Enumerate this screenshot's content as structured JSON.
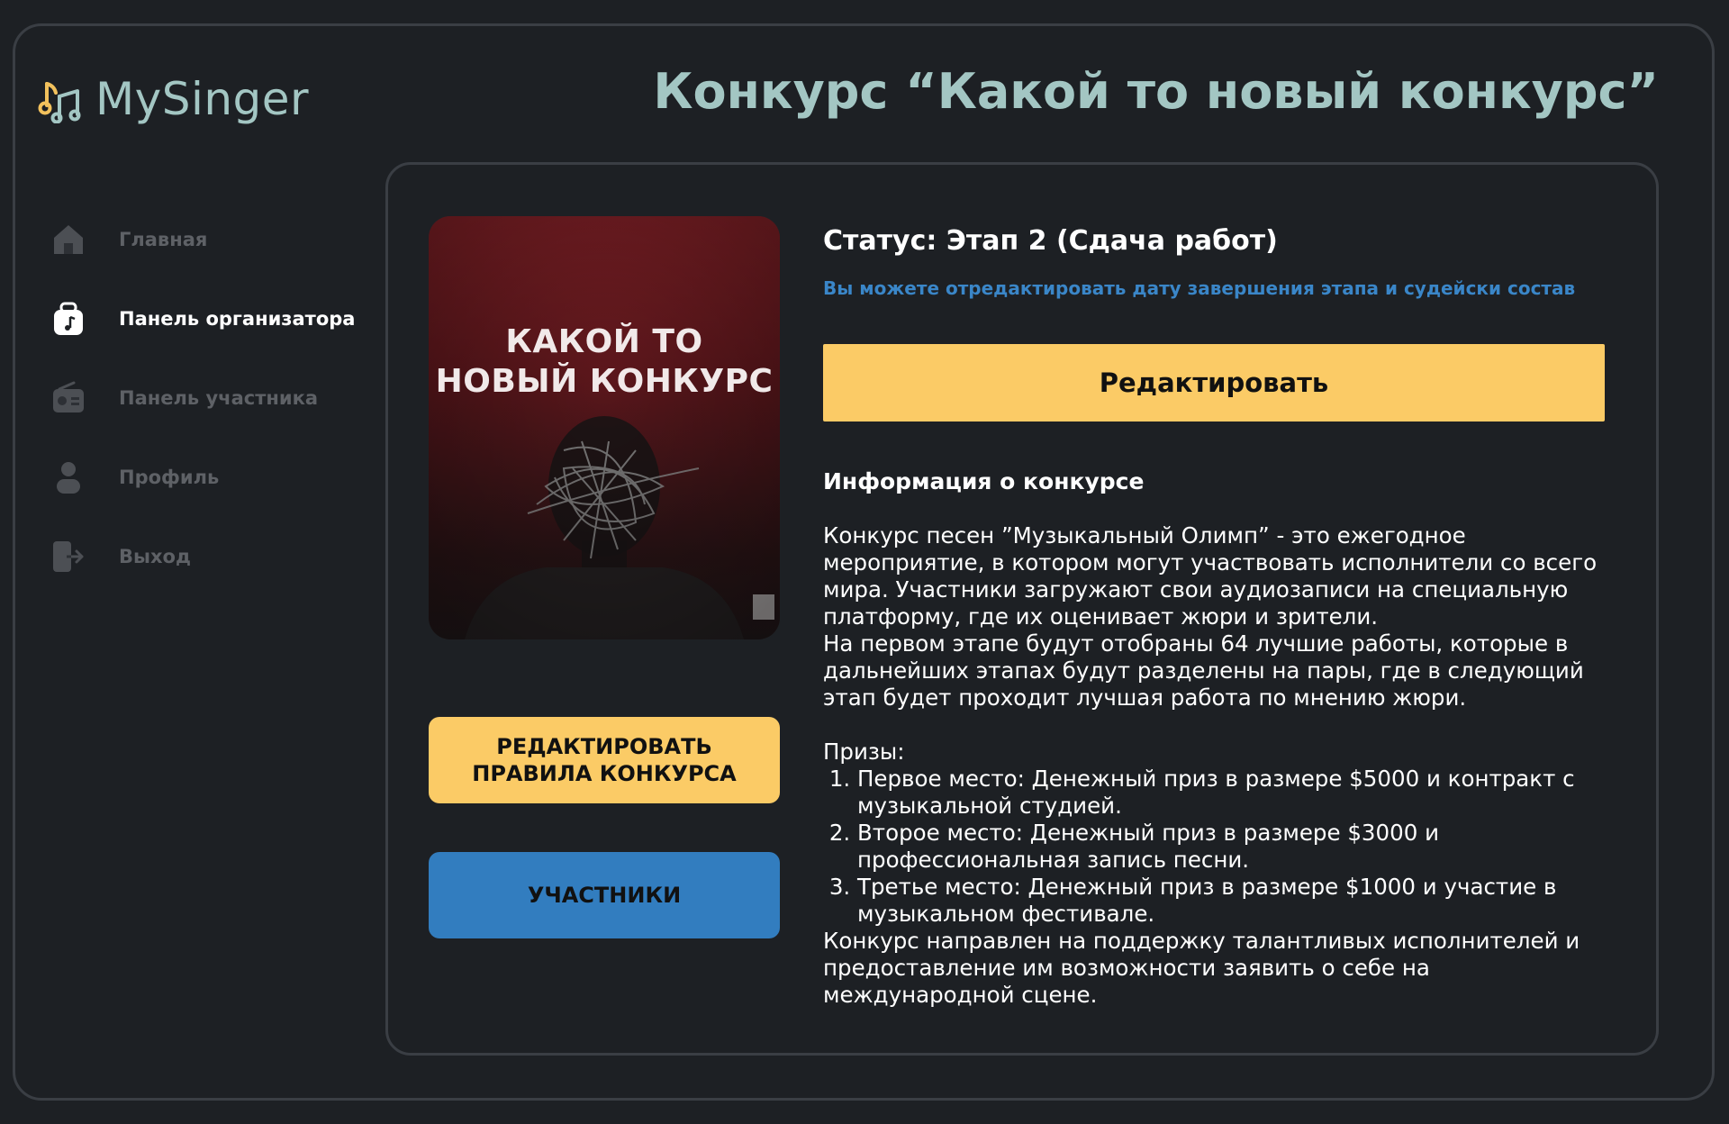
{
  "app": {
    "name": "MySinger"
  },
  "page_title": "Конкурс “Какой то новый конкурс”",
  "sidebar": {
    "items": [
      {
        "label": "Главная",
        "icon": "home-icon",
        "active": false
      },
      {
        "label": "Панель организатора",
        "icon": "music-bag-icon",
        "active": true
      },
      {
        "label": "Панель участника",
        "icon": "radio-icon",
        "active": false
      },
      {
        "label": "Профиль",
        "icon": "user-icon",
        "active": false
      },
      {
        "label": "Выход",
        "icon": "logout-icon",
        "active": false
      }
    ]
  },
  "contest": {
    "poster_title": "КАКОЙ ТО НОВЫЙ КОНКУРС",
    "rules_button": "РЕДАКТИРОВАТЬ  ПРАВИЛА КОНКУРСА",
    "participants_button": "УЧАСТНИКИ",
    "status": "Статус: Этап 2 (Сдача работ)",
    "status_hint": "Вы можете отредактировать дату завершения этапа и судейски состав",
    "edit_button": "Редактировать",
    "info_heading": "Информация о конкурсе",
    "info_paragraph_1": "Конкурс песен ”Музыкальный Олимп” - это ежегодное мероприятие, в котором могут участвовать исполнители со всего мира. Участники загружают свои аудиозаписи на специальную платформу, где их оценивает жюри и зрители.",
    "info_paragraph_2": "На первом этапе будут отобраны 64 лучшие работы, которые в дальнейших этапах будут разделены на пары, где в следующий этап будет проходит лучшая работа по мнению жюри.",
    "prizes_label": "Призы:",
    "prizes": [
      "Первое место: Денежный приз в размере $5000 и контракт с музыкальной студией.",
      "Второе место: Денежный приз в размере $3000 и профессиональная запись песни.",
      "Третье место: Денежный приз в размере $1000 и участие в музыкальном фестивале."
    ],
    "info_closing": "Конкурс направлен на поддержку талантливых исполнителей и предоставление им возможности заявить о себе на международной сцене."
  },
  "colors": {
    "background": "#1d2024",
    "accent_teal": "#a3c6c3",
    "accent_yellow": "#fbcb66",
    "accent_blue": "#327dbf",
    "logo_gold": "#f2c15c",
    "muted": "#5e6166"
  }
}
